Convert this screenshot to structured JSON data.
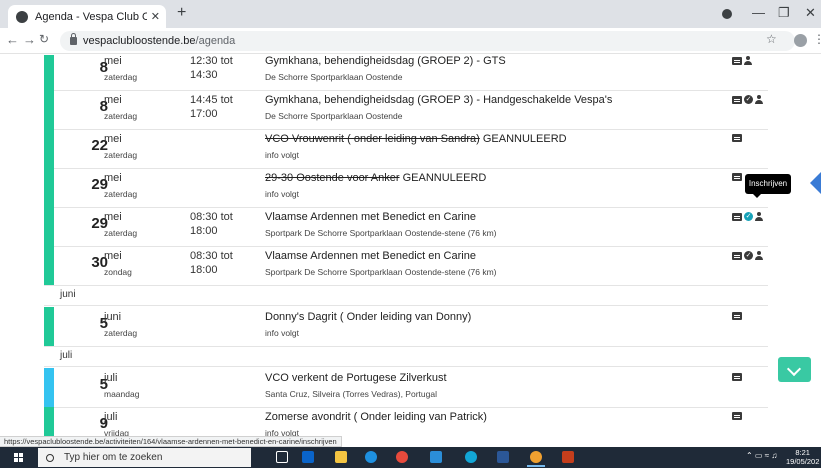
{
  "browser": {
    "tab_title": "Agenda - Vespa Club Oostende | …",
    "tab_close": "✕",
    "new_tab": "+",
    "url_host": "vespaclubloostende.be",
    "url_path": "/agenda",
    "status_url": "https://vespaclubloostende.be/activiteiten/164/vlaamse-ardennen-met-benedict-en-carine/inschrijven"
  },
  "events_top": [
    {
      "day": "8",
      "month": "mei",
      "weekday": "zaterdag",
      "time_start": "12:30 tot",
      "time_end": "14:30",
      "title": "Gymkhana, behendigheidsdag (GROEP 2) - GTS",
      "title_struck": "",
      "location": "De Schorre Sportparklaan Oostende",
      "icons": [
        "calendar",
        "user"
      ],
      "bar": "green"
    },
    {
      "day": "8",
      "month": "mei",
      "weekday": "zaterdag",
      "time_start": "14:45 tot",
      "time_end": "17:00",
      "title": "Gymkhana, behendigheidsdag (GROEP 3) - Handgeschakelde Vespa's",
      "title_struck": "",
      "location": "De Schorre Sportparklaan Oostende",
      "icons": [
        "calendar",
        "check",
        "user"
      ],
      "bar": "green"
    },
    {
      "day": "22",
      "month": "mei",
      "weekday": "zaterdag",
      "time_start": "",
      "time_end": "",
      "title": " GEANNULEERD",
      "title_struck": "VCO Vrouwenrit ( onder leiding van Sandra)",
      "location": "info volgt",
      "icons": [
        "calendar"
      ],
      "bar": "green"
    },
    {
      "day": "29",
      "month": "mei",
      "weekday": "zaterdag",
      "time_start": "",
      "time_end": "",
      "title": " GEANNULEERD",
      "title_struck": "29-30 Oostende voor Anker",
      "location": "info volgt",
      "icons": [
        "calendar"
      ],
      "bar": "green"
    },
    {
      "day": "29",
      "month": "mei",
      "weekday": "zaterdag",
      "time_start": "08:30 tot",
      "time_end": "18:00",
      "title": "Vlaamse Ardennen met Benedict en Carine",
      "title_struck": "",
      "location": "Sportpark De Schorre Sportparklaan Oostende-stene (76 km)",
      "icons": [
        "calendar",
        "check-teal",
        "user"
      ],
      "bar": "green"
    },
    {
      "day": "30",
      "month": "mei",
      "weekday": "zondag",
      "time_start": "08:30 tot",
      "time_end": "18:00",
      "title": "Vlaamse Ardennen met Benedict en Carine",
      "title_struck": "",
      "location": "Sportpark De Schorre Sportparklaan Oostende-stene (76 km)",
      "icons": [
        "calendar",
        "check",
        "user"
      ],
      "bar": "green"
    }
  ],
  "sections": {
    "juni": "juni",
    "juli": "juli"
  },
  "events_juni": [
    {
      "day": "5",
      "month": "juni",
      "weekday": "zaterdag",
      "time_start": "",
      "time_end": "",
      "title": "Donny's Dagrit ( Onder leiding van Donny)",
      "title_struck": "",
      "location": "info volgt",
      "icons": [
        "calendar"
      ],
      "bar": "green"
    }
  ],
  "events_juli": [
    {
      "day": "5",
      "month": "juli",
      "weekday": "maandag",
      "time_start": "",
      "time_end": "",
      "title": "VCO verkent de Portugese Zilverkust",
      "title_struck": "",
      "location": "Santa Cruz, Silveira (Torres Vedras), Portugal",
      "icons": [
        "calendar"
      ],
      "bar": "blue"
    },
    {
      "day": "9",
      "month": "juli",
      "weekday": "vrijdag",
      "time_start": "",
      "time_end": "",
      "title": "Zomerse avondrit ( Onder leiding van Patrick)",
      "title_struck": "",
      "location": "info volgt",
      "icons": [
        "calendar"
      ],
      "bar": "green"
    }
  ],
  "tooltip": "Inschrijven",
  "taskbar": {
    "search_placeholder": "Typ hier om te zoeken",
    "time": "8:21",
    "date": "19/05/202"
  },
  "colors": {
    "green_bar": "#20c997",
    "blue_bar": "#34c3f0",
    "accent_button": "#39c9a3"
  }
}
